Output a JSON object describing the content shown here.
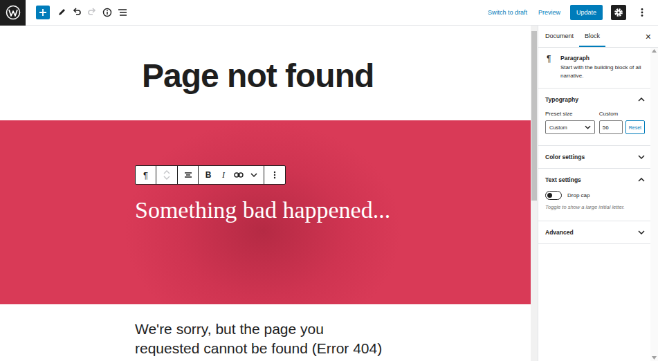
{
  "topbar": {
    "undo": {
      "disabled": false
    },
    "redo": {
      "disabled": true
    },
    "switch_to_draft": "Switch to draft",
    "preview": "Preview",
    "update": "Update",
    "settings": {
      "selected": true
    }
  },
  "editor": {
    "title": "Page not found",
    "cover": {
      "text": "Something bad happened..."
    },
    "block_toolbar": {
      "block_icon": "¶",
      "bold": "B",
      "italic": "I"
    },
    "paragraph": "We're sorry, but the page you requested cannot be found (Error 404)"
  },
  "sidebar": {
    "tabs": [
      {
        "label": "Document",
        "selected": false
      },
      {
        "label": "Block",
        "selected": true
      }
    ],
    "close": "×",
    "block": {
      "icon": "¶",
      "name": "Paragraph",
      "description": "Start with the building block of all narrative."
    },
    "panels": [
      {
        "title": "Typography",
        "expanded": true,
        "kind": "typography",
        "preset_label": "Preset size",
        "custom_label": "Custom",
        "preset_value": "Custom",
        "custom_value": "56",
        "reset": "Reset"
      },
      {
        "title": "Color settings",
        "expanded": false,
        "kind": "plain"
      },
      {
        "title": "Text settings",
        "expanded": true,
        "kind": "text",
        "toggle_label": "Drop cap",
        "on": false,
        "help": "Toggle to show a large initial letter."
      },
      {
        "title": "Advanced",
        "expanded": false,
        "kind": "plain"
      }
    ]
  }
}
